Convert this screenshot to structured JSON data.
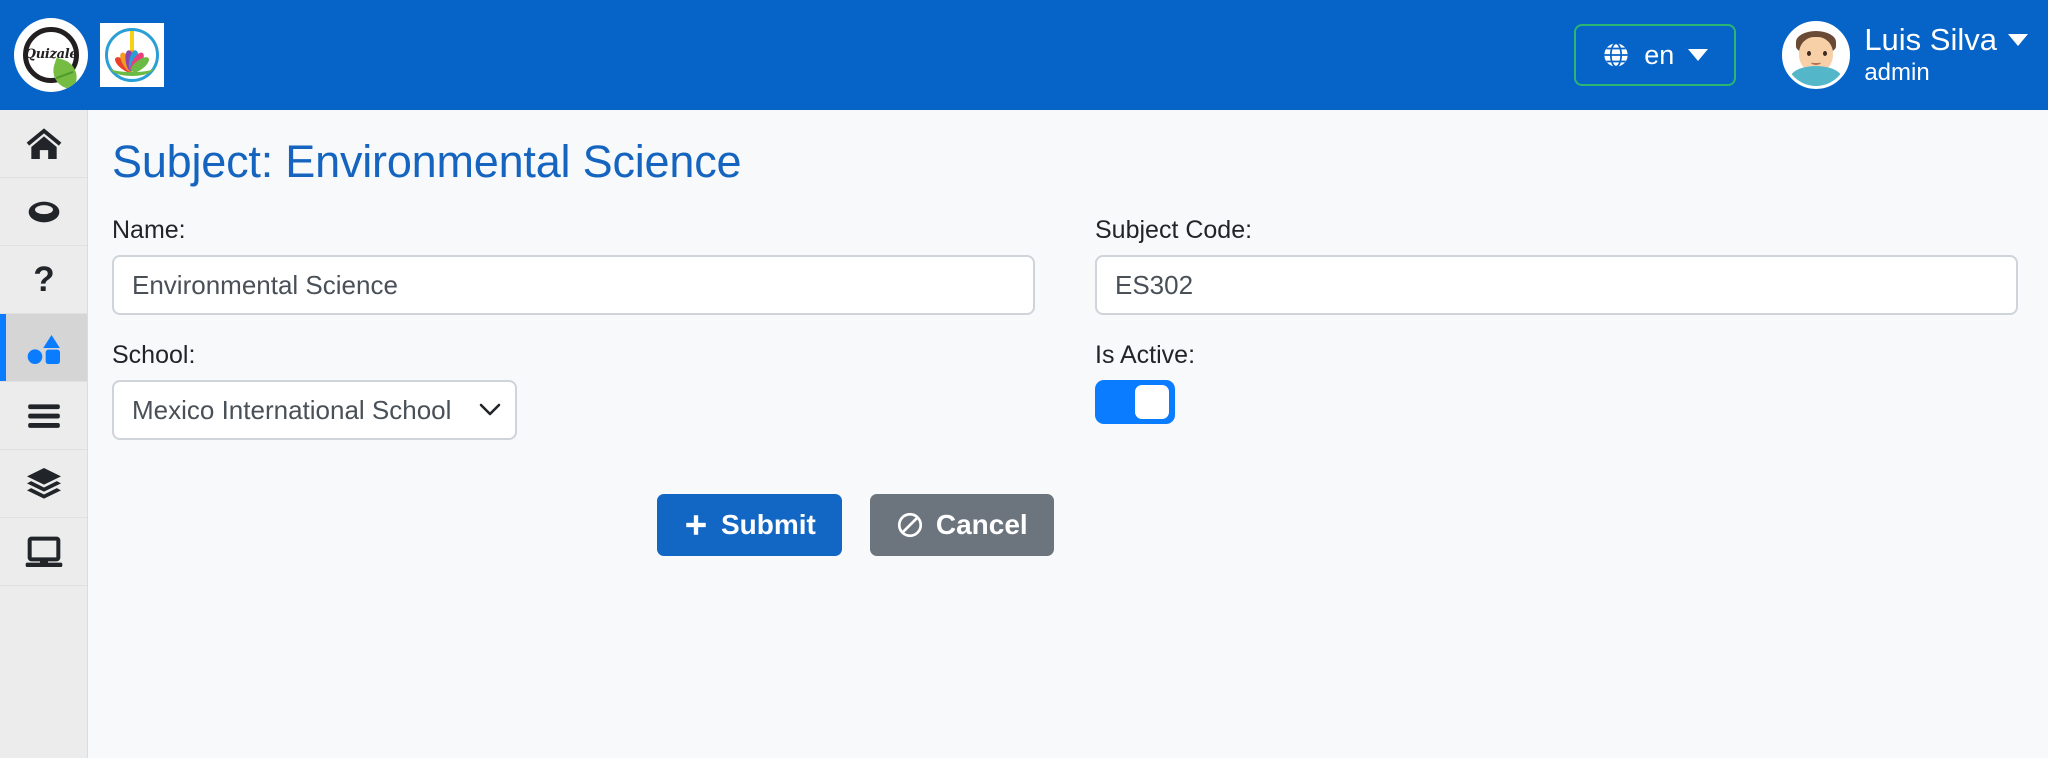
{
  "header": {
    "brand_logo_name": "quizale-logo",
    "brand_wordmark": "Quizale",
    "school_logo_name": "school-lotus-logo",
    "language": {
      "icon": "globe-icon",
      "code": "en",
      "caret": "chevron-down-icon"
    },
    "user": {
      "avatar": "user-avatar",
      "name": "Luis Silva",
      "role": "admin",
      "caret": "chevron-down-icon"
    },
    "colors": {
      "header_bg": "#0663c7",
      "lang_border": "#2bb673"
    }
  },
  "sidebar": {
    "items": [
      {
        "icon": "home-icon",
        "name": "sidebar-item-home",
        "active": false
      },
      {
        "icon": "ring-icon",
        "name": "sidebar-item-ring",
        "active": false
      },
      {
        "icon": "question-mark-icon",
        "name": "sidebar-item-help",
        "active": false
      },
      {
        "icon": "shapes-icon",
        "name": "sidebar-item-subjects",
        "active": true
      },
      {
        "icon": "bars-icon",
        "name": "sidebar-item-menu",
        "active": false
      },
      {
        "icon": "layers-icon",
        "name": "sidebar-item-layers",
        "active": false
      },
      {
        "icon": "laptop-icon",
        "name": "sidebar-item-devices",
        "active": false
      }
    ],
    "active_indicator_color": "#0a7cff"
  },
  "main": {
    "page_title": "Subject: Environmental Science",
    "title_color": "#1565c0",
    "fields": {
      "name": {
        "label": "Name:",
        "value": "Environmental Science",
        "placeholder": ""
      },
      "subject_code": {
        "label": "Subject Code:",
        "value": "ES302",
        "placeholder": ""
      },
      "school": {
        "label": "School:",
        "value": "Mexico International School",
        "options": [
          "Mexico International School"
        ]
      },
      "is_active": {
        "label": "Is Active:",
        "value": "on",
        "checked": true
      }
    },
    "buttons": {
      "submit": {
        "label": "Submit",
        "icon": "plus-icon",
        "color": "#1266c4"
      },
      "cancel": {
        "label": "Cancel",
        "icon": "ban-icon",
        "color": "#6c757d"
      }
    }
  }
}
